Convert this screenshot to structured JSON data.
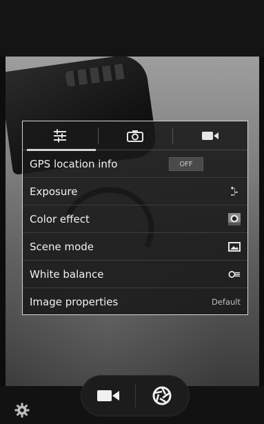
{
  "tabs": [
    {
      "name": "settings-sliders-icon",
      "active": true
    },
    {
      "name": "camera-icon",
      "active": false
    },
    {
      "name": "video-camera-icon",
      "active": false
    }
  ],
  "settings": {
    "gps": {
      "label": "GPS location info",
      "toggle": "OFF"
    },
    "exposure": {
      "label": "Exposure"
    },
    "color_effect": {
      "label": "Color effect"
    },
    "scene_mode": {
      "label": "Scene mode"
    },
    "white_balance": {
      "label": "White balance"
    },
    "image_properties": {
      "label": "Image properties",
      "value": "Default"
    }
  },
  "bottom": {
    "video_button": "video-camera-icon",
    "shutter_button": "shutter-icon",
    "settings_button": "gear-icon"
  },
  "colors": {
    "panel_bg": "#191919",
    "panel_border": "#d9d9d9",
    "text": "#f2f2f2"
  }
}
